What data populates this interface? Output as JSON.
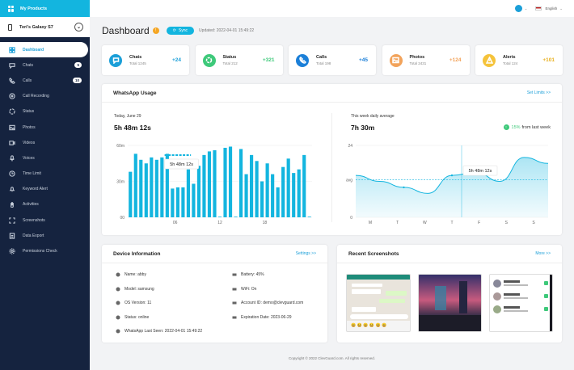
{
  "sidebar": {
    "title": "My Products",
    "device": "Teri's Galaxy S7",
    "items": [
      {
        "label": "Dashboard",
        "icon": "dashboard-icon",
        "active": true
      },
      {
        "label": "Chats",
        "icon": "chat-icon",
        "badge": "5"
      },
      {
        "label": "Calls",
        "icon": "phone-icon",
        "badge": "10"
      },
      {
        "label": "Call Recording",
        "icon": "recording-icon"
      },
      {
        "label": "Status",
        "icon": "status-icon"
      },
      {
        "label": "Photos",
        "icon": "image-icon"
      },
      {
        "label": "Videos",
        "icon": "video-icon"
      },
      {
        "label": "Voices",
        "icon": "mic-icon"
      },
      {
        "label": "Time Limit",
        "icon": "clock-icon"
      },
      {
        "label": "Keyword Alert",
        "icon": "bell-icon"
      },
      {
        "label": "Activities",
        "icon": "hand-icon"
      },
      {
        "label": "Screenshots",
        "icon": "screenshot-icon"
      },
      {
        "label": "Data Export",
        "icon": "export-icon"
      },
      {
        "label": "Permissions Check",
        "icon": "settings-icon"
      }
    ]
  },
  "topbar": {
    "language": "English"
  },
  "header": {
    "title": "Dashboard",
    "badge": "!",
    "sync_label": "Sync",
    "updated": "Updated: 2022-04-01 15:49:22"
  },
  "stats": [
    {
      "name": "Chats",
      "total": "Total 1245",
      "delta": "+24",
      "color": "#1b9fd8",
      "delta_color": "#1b9fd8"
    },
    {
      "name": "Status",
      "total": "Total 212",
      "delta": "+321",
      "color": "#3ec97a",
      "delta_color": "#3ec97a"
    },
    {
      "name": "Calls",
      "total": "Total 198",
      "delta": "+45",
      "color": "#1b7fd8",
      "delta_color": "#1b7fd8"
    },
    {
      "name": "Photos",
      "total": "Total 2431",
      "delta": "+124",
      "color": "#f2a35b",
      "delta_color": "#f2a35b"
    },
    {
      "name": "Alerts",
      "total": "Total 124",
      "delta": "+101",
      "color": "#f5c33b",
      "delta_color": "#e8b020"
    }
  ],
  "usage": {
    "title": "WhatsApp Usage",
    "link": "Set Limits >>",
    "today_label": "Today, June 29",
    "today_value": "5h 48m 12s",
    "tooltip": "5h 48m 12s",
    "week_label": "This week daily average",
    "week_value": "7h 30m",
    "change_pct": "15%",
    "change_text": "from last week",
    "week_tooltip": "5h 48m 12s"
  },
  "chart_data": [
    {
      "type": "bar",
      "ylabels": [
        "60m",
        "30m",
        "00"
      ],
      "xlabels": [
        "06",
        "12",
        "18"
      ],
      "ylim": [
        0,
        60
      ],
      "values": [
        38,
        53,
        48,
        45,
        50,
        48,
        50,
        53,
        24,
        25,
        25,
        40,
        28,
        43,
        52,
        55,
        56,
        0,
        58,
        59,
        0,
        57,
        36,
        52,
        47,
        30,
        45,
        36,
        25,
        42,
        49,
        37,
        40,
        52,
        0
      ]
    },
    {
      "type": "area",
      "categories": [
        "M",
        "T",
        "W",
        "T",
        "F",
        "S",
        "S"
      ],
      "ylabels": [
        "24",
        "avg",
        "0"
      ],
      "ylim": [
        0,
        24
      ],
      "avg": 12.5,
      "values": [
        14,
        12,
        10,
        8,
        14,
        15,
        12,
        20,
        18
      ]
    }
  ],
  "device": {
    "title": "Device Information",
    "link": "Settings >>",
    "left": [
      "Name: abby",
      "Model: samsung",
      "OS Version: 11",
      "Status: online",
      "WhatsApp Last Seen: 2022-04-01 15:49:22"
    ],
    "right": [
      "Battery: 45%",
      "WiFi: On",
      "Account ID: demo@clevguard.com",
      "Expiration Date: 2023-06-29"
    ]
  },
  "screens": {
    "title": "Recent Screenshots",
    "link": "More >>"
  },
  "footer": "Copyright © 2022 ClevGuard.com. All rights reserved."
}
